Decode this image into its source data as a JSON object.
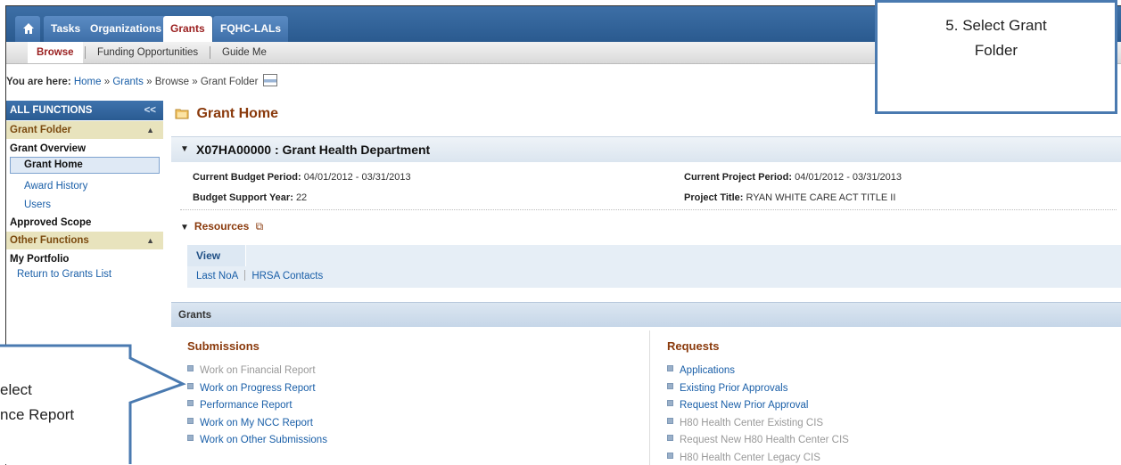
{
  "top_nav": {
    "tabs": [
      {
        "label": "Tasks"
      },
      {
        "label": "Organizations"
      },
      {
        "label": "Grants"
      },
      {
        "label": "FQHC-LALs"
      }
    ]
  },
  "sub_nav": {
    "items": [
      {
        "label": "Browse"
      },
      {
        "label": "Funding Opportunities"
      },
      {
        "label": "Guide Me"
      }
    ]
  },
  "breadcrumb": {
    "prefix": "You are here:",
    "path": [
      "Home",
      "Grants",
      "Browse",
      "Grant Folder"
    ],
    "sep": "»"
  },
  "sidebar": {
    "header": "ALL FUNCTIONS",
    "collapse": "<<",
    "grant_folder": "Grant Folder",
    "grant_overview": "Grant Overview",
    "grant_home": "Grant Home",
    "award_history": "Award History",
    "users": "Users",
    "approved_scope": "Approved Scope",
    "other_functions": "Other Functions",
    "my_portfolio": "My Portfolio",
    "return_to_list": "Return to Grants List"
  },
  "main": {
    "title": "Grant Home",
    "grant_id": "X07HA00000",
    "grant_name": "Grant Health Department",
    "budget_period_label": "Current Budget Period:",
    "budget_period": "04/01/2012 - 03/31/2013",
    "budget_year_label": "Budget Support Year:",
    "budget_year": "22",
    "project_period_label": "Current Project Period:",
    "project_period": "04/01/2012 - 03/31/2013",
    "project_title_label": "Project Title:",
    "project_title": "RYAN WHITE CARE ACT TITLE II",
    "resources": "Resources",
    "view_tab": "View",
    "res_links": [
      "Last NoA",
      "HRSA Contacts"
    ],
    "grants_bar": "Grants",
    "submissions_title": "Submissions",
    "submissions": [
      {
        "label": "Work on Financial Report",
        "enabled": false
      },
      {
        "label": "Work on Progress Report",
        "enabled": true
      },
      {
        "label": "Performance Report",
        "enabled": true
      },
      {
        "label": "Work on My NCC Report",
        "enabled": true
      },
      {
        "label": "Work on Other Submissions",
        "enabled": true
      }
    ],
    "requests_title": "Requests",
    "requests": [
      {
        "label": "Applications",
        "enabled": true
      },
      {
        "label": "Existing Prior Approvals",
        "enabled": true
      },
      {
        "label": "Request New Prior Approval",
        "enabled": true
      },
      {
        "label": "H80 Health Center Existing CIS",
        "enabled": false
      },
      {
        "label": "Request New H80 Health Center CIS",
        "enabled": false
      },
      {
        "label": "H80 Health Center Legacy CIS",
        "enabled": false
      }
    ]
  },
  "callouts": {
    "top_line1": "5. Select Grant",
    "top_line2": "Folder",
    "left_line1": "elect",
    "left_line2": "nce Report"
  },
  "colors": {
    "nav_blue": "#2a5a8f",
    "accent_brown": "#8a3a0c",
    "link_blue": "#1a5fa8",
    "callout_border": "#4a7ab0"
  }
}
